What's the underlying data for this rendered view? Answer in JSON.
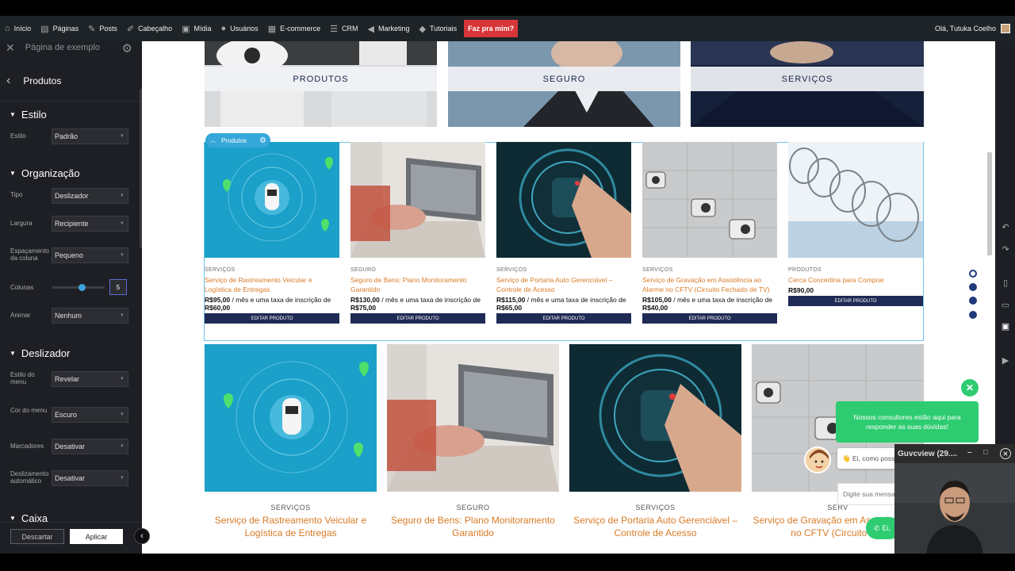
{
  "adminbar": {
    "items": [
      {
        "icon": "wordpress-icon",
        "label": "Início"
      },
      {
        "icon": "pages-icon",
        "label": "Páginas"
      },
      {
        "icon": "pin-icon",
        "label": "Posts"
      },
      {
        "icon": "brush-icon",
        "label": "Cabeçalho"
      },
      {
        "icon": "media-icon",
        "label": "Mídia"
      },
      {
        "icon": "users-icon",
        "label": "Usuários"
      },
      {
        "icon": "grid-icon",
        "label": "E-commerce"
      },
      {
        "icon": "feedback-icon",
        "label": "CRM"
      },
      {
        "icon": "megaphone-icon",
        "label": "Marketing"
      },
      {
        "icon": "graduation-icon",
        "label": "Tutoriais"
      }
    ],
    "cta": "Faz pra mim?",
    "greeting": "Olá, Tutuka Coelho"
  },
  "panel": {
    "page_title": "Página de exemplo",
    "section_title": "Produtos",
    "estilo": {
      "heading": "Estilo",
      "estilo_label": "Estilo",
      "estilo_value": "Padrão"
    },
    "organizacao": {
      "heading": "Organização",
      "tipo_label": "Tipo",
      "tipo_value": "Deslizador",
      "largura_label": "Largura",
      "largura_value": "Recipiente",
      "espacamento_label": "Espaçamento da coluna",
      "espacamento_value": "Pequeno",
      "colunas_label": "Colunas",
      "colunas_value": "5",
      "colunas_fraction": 0.56,
      "animar_label": "Animar",
      "animar_value": "Nenhum"
    },
    "deslizador": {
      "heading": "Deslizador",
      "estilo_menu_label": "Estilo do menu",
      "estilo_menu_value": "Revelar",
      "cor_menu_label": "Cor do menu",
      "cor_menu_value": "Escuro",
      "marcadores_label": "Marcadores",
      "marcadores_value": "Desativar",
      "auto_label": "Deslizamento automático",
      "auto_value": "Desativar"
    },
    "caixa_heading": "Caixa",
    "discard_label": "Descartar",
    "apply_label": "Aplicar"
  },
  "categories": [
    {
      "label": "PRODUTOS"
    },
    {
      "label": "SEGURO"
    },
    {
      "label": "SERVIÇOS"
    }
  ],
  "selection_tab": "Produtos",
  "products_small": [
    {
      "cat": "SERVIÇOS",
      "title": "Serviço de Rastreamento Veicular e Logística de Entregas",
      "price": "R$95,00",
      "price_suffix": " / mês e uma taxa de inscrição de ",
      "signup": "R$60,00",
      "button": "EDITAR PRODUTO"
    },
    {
      "cat": "SEGURO",
      "title": "Seguro de Bens: Plano Monitoramento Garantido",
      "price": "R$130,00",
      "price_suffix": " / mês e uma taxa de inscrição de ",
      "signup": "R$75,00",
      "button": "EDITAR PRODUTO"
    },
    {
      "cat": "SERVIÇOS",
      "title": "Serviço de Portaria Auto Gerenciável – Controle de Acesso",
      "price": "R$115,00",
      "price_suffix": " / mês e uma taxa de inscrição de ",
      "signup": "R$65,00",
      "button": "EDITAR PRODUTO"
    },
    {
      "cat": "SERVIÇOS",
      "title": "Serviço de Gravação em Assistência ao Alarme no CFTV (Circuito Fechado de TV)",
      "price": "R$105,00",
      "price_suffix": " / mês e uma taxa de inscrição de ",
      "signup": "R$40,00",
      "button": "EDITAR PRODUTO"
    },
    {
      "cat": "PRODUTOS",
      "title": "Cerca Concertina para Comprar",
      "price": "R$90,00",
      "price_suffix": "",
      "signup": "",
      "button": "EDITAR PRODUTO"
    }
  ],
  "products_large": [
    {
      "cat": "SERVIÇOS",
      "title": "Serviço de Rastreamento Veicular e Logística de Entregas"
    },
    {
      "cat": "SEGURO",
      "title": "Seguro de Bens: Plano Monitoramento Garantido"
    },
    {
      "cat": "SERVIÇOS",
      "title": "Serviço de Portaria Auto Gerenciável – Controle de Acesso"
    },
    {
      "cat": "SERV",
      "title": "Serviço de Gravação em Assistê Alarme no CFTV (Circuito TV)"
    }
  ],
  "chat": {
    "bubble": "Nossos consultores estão aqui para responder as suas dúvidas!",
    "message": "👋 Ei, como posso",
    "input_placeholder": "Digite sua mensa",
    "whatsapp": "Ei,"
  },
  "webcam": {
    "title": "Guvcview  (29...."
  },
  "colors": {
    "accent": "#d97a26",
    "navy": "#1f2a55",
    "chat_green": "#2ecc71",
    "selection": "#35a7d8"
  }
}
